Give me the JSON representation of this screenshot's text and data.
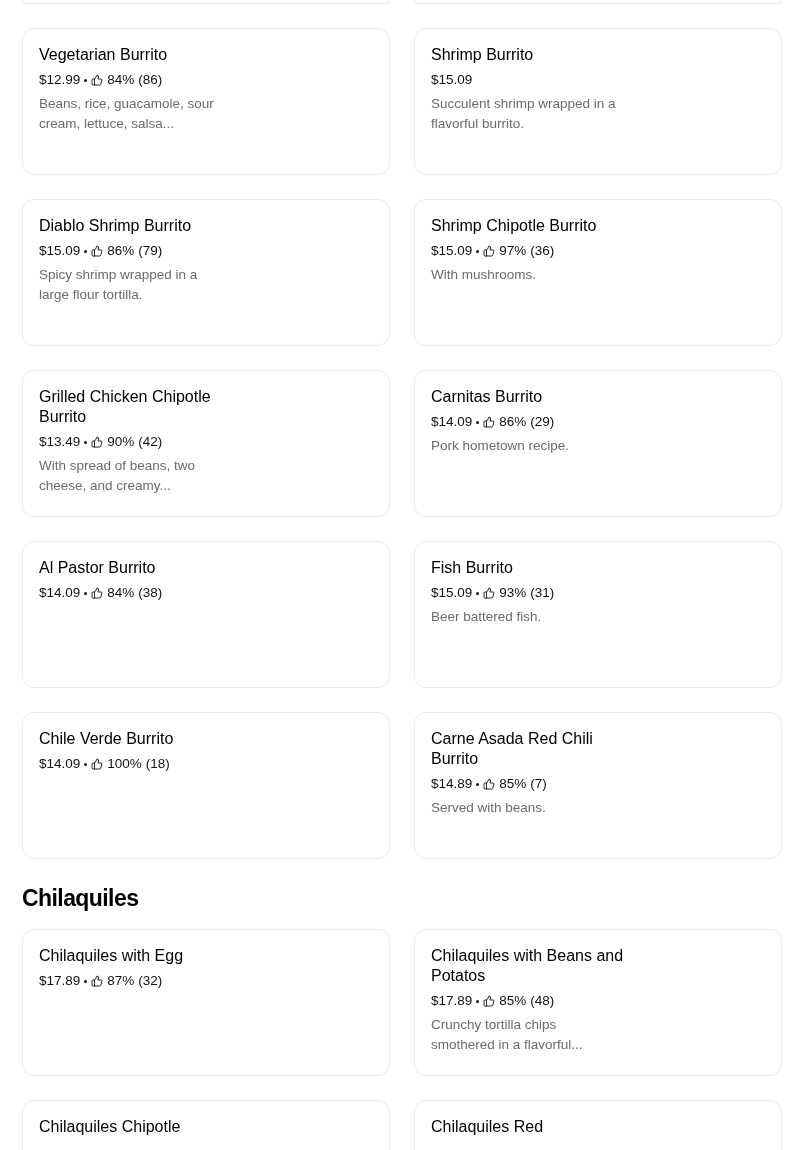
{
  "sections": [
    {
      "items": [
        {
          "name": "Vegetarian Burrito",
          "price": "$12.99",
          "rating": "84%",
          "count": "(86)",
          "description": "Beans, rice, guacamole, sour cream, lettuce, salsa..."
        },
        {
          "name": "Shrimp Burrito",
          "price": "$15.09",
          "description": "Succulent shrimp wrapped in a flavorful burrito."
        },
        {
          "name": "Diablo Shrimp Burrito",
          "price": "$15.09",
          "rating": "86%",
          "count": "(79)",
          "description": "Spicy shrimp wrapped in a large flour tortilla."
        },
        {
          "name": "Shrimp Chipotle Burrito",
          "price": "$15.09",
          "rating": "97%",
          "count": "(36)",
          "description": "With mushrooms."
        },
        {
          "name": "Grilled Chicken Chipotle Burrito",
          "price": "$13.49",
          "rating": "90%",
          "count": "(42)",
          "description": "With spread of beans, two cheese, and creamy..."
        },
        {
          "name": "Carnitas Burrito",
          "price": "$14.09",
          "rating": "86%",
          "count": "(29)",
          "description": "Pork hometown recipe."
        },
        {
          "name": "Al Pastor Burrito",
          "price": "$14.09",
          "rating": "84%",
          "count": "(38)"
        },
        {
          "name": "Fish Burrito",
          "price": "$15.09",
          "rating": "93%",
          "count": "(31)",
          "description": "Beer battered fish."
        },
        {
          "name": "Chile Verde Burrito",
          "price": "$14.09",
          "rating": "100%",
          "count": "(18)"
        },
        {
          "name": "Carne Asada Red Chili Burrito",
          "price": "$14.89",
          "rating": "85%",
          "count": "(7)",
          "description": "Served with beans."
        }
      ]
    },
    {
      "heading": "Chilaquiles",
      "items": [
        {
          "name": "Chilaquiles with Egg",
          "price": "$17.89",
          "rating": "87%",
          "count": "(32)"
        },
        {
          "name": "Chilaquiles with Beans and Potatos",
          "price": "$17.89",
          "rating": "85%",
          "count": "(48)",
          "description": "Crunchy tortilla chips smothered in a flavorful..."
        },
        {
          "name": "Chilaquiles Chipotle"
        },
        {
          "name": "Chilaquiles Red"
        }
      ]
    }
  ]
}
